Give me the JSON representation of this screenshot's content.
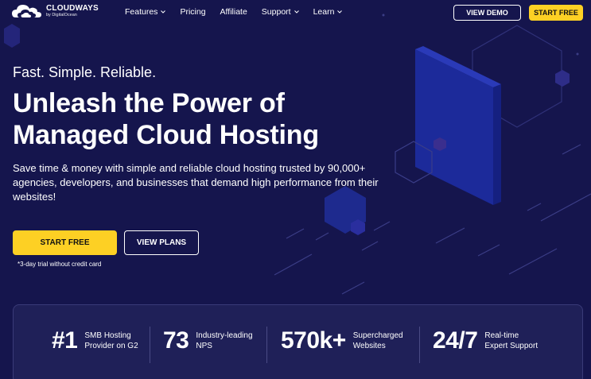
{
  "brand": {
    "name": "CLOUDWAYS",
    "sub": "by DigitalOcean"
  },
  "nav": {
    "items": [
      {
        "label": "Features",
        "dropdown": true
      },
      {
        "label": "Pricing",
        "dropdown": false
      },
      {
        "label": "Affiliate",
        "dropdown": false
      },
      {
        "label": "Support",
        "dropdown": true
      },
      {
        "label": "Learn",
        "dropdown": true
      }
    ],
    "view_demo": "VIEW DEMO",
    "start_free": "START FREE"
  },
  "hero": {
    "tagline": "Fast. Simple. Reliable.",
    "headline_line1": "Unleash the Power of",
    "headline_line2": "Managed Cloud Hosting",
    "description": "Save time & money with simple and reliable cloud hosting trusted by 90,000+ agencies, developers, and businesses that demand high performance from their websites!",
    "cta_primary": "START FREE",
    "cta_secondary": "VIEW PLANS",
    "trial_note": "*3-day trial without credit card"
  },
  "stats": [
    {
      "value": "#1",
      "label_line1": "SMB Hosting",
      "label_line2": "Provider on G2"
    },
    {
      "value": "73",
      "label_line1": "Industry-leading",
      "label_line2": "NPS"
    },
    {
      "value": "570k+",
      "label_line1": "Supercharged",
      "label_line2": "Websites"
    },
    {
      "value": "24/7",
      "label_line1": "Real-time",
      "label_line2": "Expert Support"
    }
  ],
  "colors": {
    "background": "#15154d",
    "accent_yellow": "#fdd024",
    "panel": "#1f2058",
    "text": "#ffffff"
  },
  "icons": {
    "logo": "cloud-icon",
    "dropdown": "chevron-down-icon"
  }
}
